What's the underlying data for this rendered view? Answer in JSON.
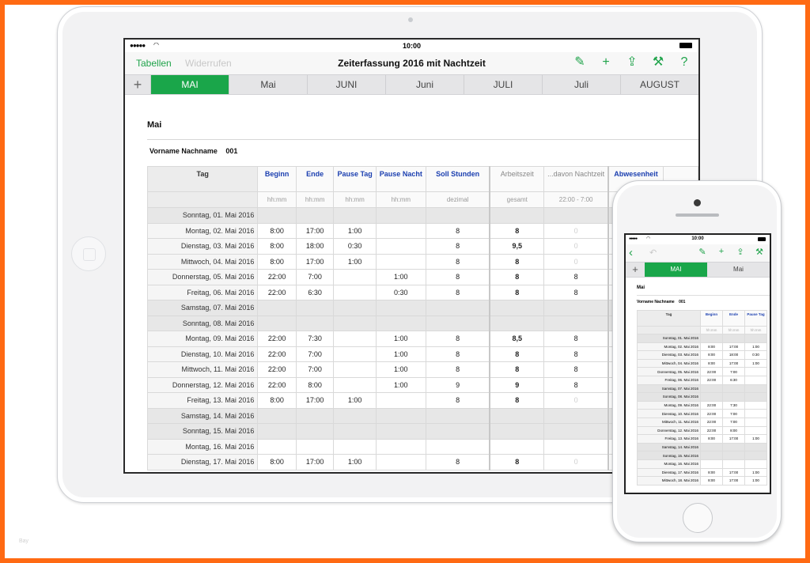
{
  "colors": {
    "frame": "#ff6a13",
    "accent": "#1aa64a",
    "header_blue": "#1b3fb0"
  },
  "footer_mark": "Bay",
  "ipad": {
    "status": {
      "time": "10:00"
    },
    "nav": {
      "back_label": "Tabellen",
      "undo_label": "Widerrufen",
      "title": "Zeiterfassung 2016 mit Nachtzeit",
      "icons": [
        "brush-icon",
        "plus-icon",
        "share-icon",
        "wrench-icon",
        "help-icon"
      ],
      "icon_glyphs": [
        "✎",
        "+",
        "⇪",
        "⚒",
        "?"
      ]
    },
    "tabs": [
      "MAI",
      "Mai",
      "JUNI",
      "Juni",
      "JULI",
      "Juli",
      "AUGUST"
    ],
    "active_tab": 0,
    "sheet": {
      "heading": "Mai",
      "person_label": "Vorname Nachname",
      "person_number": "001",
      "columns": [
        {
          "label": "Tag",
          "unit": ""
        },
        {
          "label": "Beginn",
          "unit": "hh:mm"
        },
        {
          "label": "Ende",
          "unit": "hh:mm"
        },
        {
          "label": "Pause Tag",
          "unit": "hh:mm"
        },
        {
          "label": "Pause Nacht",
          "unit": "hh:mm"
        },
        {
          "label": "Soll Stunden",
          "unit": "dezimal"
        },
        {
          "label": "Arbeitszeit",
          "unit": "gesamt"
        },
        {
          "label": "...davon Nachtzeit",
          "unit": "22:00 - 7:00"
        },
        {
          "label": "Abwesenheit",
          "unit": ""
        },
        {
          "label": "",
          "unit": ""
        }
      ],
      "rows": [
        {
          "day": "Sonntag, 01. Mai 2016",
          "weekend": true,
          "cells": [
            "",
            "",
            "",
            "",
            "",
            "",
            "",
            "",
            ""
          ]
        },
        {
          "day": "Montag, 02. Mai 2016",
          "weekend": false,
          "cells": [
            "8:00",
            "17:00",
            "1:00",
            "",
            "8",
            "8",
            "0",
            "",
            ""
          ]
        },
        {
          "day": "Dienstag, 03. Mai 2016",
          "weekend": false,
          "cells": [
            "8:00",
            "18:00",
            "0:30",
            "",
            "8",
            "9,5",
            "0",
            "",
            ""
          ]
        },
        {
          "day": "Mittwoch, 04. Mai 2016",
          "weekend": false,
          "cells": [
            "8:00",
            "17:00",
            "1:00",
            "",
            "8",
            "8",
            "0",
            "",
            ""
          ]
        },
        {
          "day": "Donnerstag, 05. Mai 2016",
          "weekend": false,
          "cells": [
            "22:00",
            "7:00",
            "",
            "1:00",
            "8",
            "8",
            "8",
            "",
            ""
          ]
        },
        {
          "day": "Freitag, 06. Mai 2016",
          "weekend": false,
          "cells": [
            "22:00",
            "6:30",
            "",
            "0:30",
            "8",
            "8",
            "8",
            "",
            ""
          ]
        },
        {
          "day": "Samstag, 07. Mai 2016",
          "weekend": true,
          "cells": [
            "",
            "",
            "",
            "",
            "",
            "",
            "",
            "",
            ""
          ]
        },
        {
          "day": "Sonntag, 08. Mai 2016",
          "weekend": true,
          "cells": [
            "",
            "",
            "",
            "",
            "",
            "",
            "",
            "",
            ""
          ]
        },
        {
          "day": "Montag, 09. Mai 2016",
          "weekend": false,
          "cells": [
            "22:00",
            "7:30",
            "",
            "1:00",
            "8",
            "8,5",
            "8",
            "",
            ""
          ]
        },
        {
          "day": "Dienstag, 10. Mai 2016",
          "weekend": false,
          "cells": [
            "22:00",
            "7:00",
            "",
            "1:00",
            "8",
            "8",
            "8",
            "",
            ""
          ]
        },
        {
          "day": "Mittwoch, 11. Mai 2016",
          "weekend": false,
          "cells": [
            "22:00",
            "7:00",
            "",
            "1:00",
            "8",
            "8",
            "8",
            "",
            ""
          ]
        },
        {
          "day": "Donnerstag, 12. Mai 2016",
          "weekend": false,
          "cells": [
            "22:00",
            "8:00",
            "",
            "1:00",
            "9",
            "9",
            "8",
            "",
            ""
          ]
        },
        {
          "day": "Freitag, 13. Mai 2016",
          "weekend": false,
          "cells": [
            "8:00",
            "17:00",
            "1:00",
            "",
            "8",
            "8",
            "0",
            "",
            ""
          ]
        },
        {
          "day": "Samstag, 14. Mai 2016",
          "weekend": true,
          "cells": [
            "",
            "",
            "",
            "",
            "",
            "",
            "",
            "",
            ""
          ]
        },
        {
          "day": "Sonntag, 15. Mai 2016",
          "weekend": true,
          "cells": [
            "",
            "",
            "",
            "",
            "",
            "",
            "",
            "",
            ""
          ]
        },
        {
          "day": "Montag, 16. Mai 2016",
          "weekend": false,
          "cells": [
            "",
            "",
            "",
            "",
            "",
            "",
            "",
            "",
            ""
          ]
        },
        {
          "day": "Dienstag, 17. Mai 2016",
          "weekend": false,
          "cells": [
            "8:00",
            "17:00",
            "1:00",
            "",
            "8",
            "8",
            "0",
            "",
            ""
          ]
        }
      ]
    }
  },
  "iphone": {
    "status": {
      "time": "10:00"
    },
    "nav": {
      "icons": [
        "back-icon",
        "undo-icon",
        "brush-icon",
        "plus-icon",
        "share-icon",
        "wrench-icon"
      ],
      "icon_glyphs": [
        "‹",
        "↶",
        "✎",
        "+",
        "⇪",
        "⚒"
      ]
    },
    "tabs": [
      "MAI",
      "Mai"
    ],
    "sheet": {
      "heading": "Mai",
      "person_label": "Vorname Nachname",
      "person_number": "001",
      "columns": [
        {
          "label": "Tag",
          "unit": ""
        },
        {
          "label": "Beginn",
          "unit": "hh:mm"
        },
        {
          "label": "Ende",
          "unit": "hh:mm"
        },
        {
          "label": "Pause Tag",
          "unit": "hh:mm"
        }
      ],
      "rows": [
        {
          "day": "Sonntag, 01. Mai 2016",
          "weekend": true,
          "cells": [
            "",
            "",
            ""
          ]
        },
        {
          "day": "Montag, 02. Mai 2016",
          "weekend": false,
          "cells": [
            "8:00",
            "17:00",
            "1:00"
          ]
        },
        {
          "day": "Dienstag, 03. Mai 2016",
          "weekend": false,
          "cells": [
            "8:00",
            "18:00",
            "0:30"
          ]
        },
        {
          "day": "Mittwoch, 04. Mai 2016",
          "weekend": false,
          "cells": [
            "8:00",
            "17:00",
            "1:00"
          ]
        },
        {
          "day": "Donnerstag, 05. Mai 2016",
          "weekend": false,
          "cells": [
            "22:00",
            "7:00",
            ""
          ]
        },
        {
          "day": "Freitag, 06. Mai 2016",
          "weekend": false,
          "cells": [
            "22:00",
            "6:30",
            ""
          ]
        },
        {
          "day": "Samstag, 07. Mai 2016",
          "weekend": true,
          "cells": [
            "",
            "",
            ""
          ]
        },
        {
          "day": "Sonntag, 08. Mai 2016",
          "weekend": true,
          "cells": [
            "",
            "",
            ""
          ]
        },
        {
          "day": "Montag, 09. Mai 2016",
          "weekend": false,
          "cells": [
            "22:00",
            "7:30",
            ""
          ]
        },
        {
          "day": "Dienstag, 10. Mai 2016",
          "weekend": false,
          "cells": [
            "22:00",
            "7:00",
            ""
          ]
        },
        {
          "day": "Mittwoch, 11. Mai 2016",
          "weekend": false,
          "cells": [
            "22:00",
            "7:00",
            ""
          ]
        },
        {
          "day": "Donnerstag, 12. Mai 2016",
          "weekend": false,
          "cells": [
            "22:00",
            "8:00",
            ""
          ]
        },
        {
          "day": "Freitag, 13. Mai 2016",
          "weekend": false,
          "cells": [
            "8:00",
            "17:00",
            "1:00"
          ]
        },
        {
          "day": "Samstag, 14. Mai 2016",
          "weekend": true,
          "cells": [
            "",
            "",
            ""
          ]
        },
        {
          "day": "Sonntag, 15. Mai 2016",
          "weekend": true,
          "cells": [
            "",
            "",
            ""
          ]
        },
        {
          "day": "Montag, 16. Mai 2016",
          "weekend": false,
          "cells": [
            "",
            "",
            ""
          ]
        },
        {
          "day": "Dienstag, 17. Mai 2016",
          "weekend": false,
          "cells": [
            "8:00",
            "17:00",
            "1:00"
          ]
        },
        {
          "day": "Mittwoch, 18. Mai 2016",
          "weekend": false,
          "cells": [
            "8:00",
            "17:00",
            "1:00"
          ]
        }
      ]
    }
  }
}
